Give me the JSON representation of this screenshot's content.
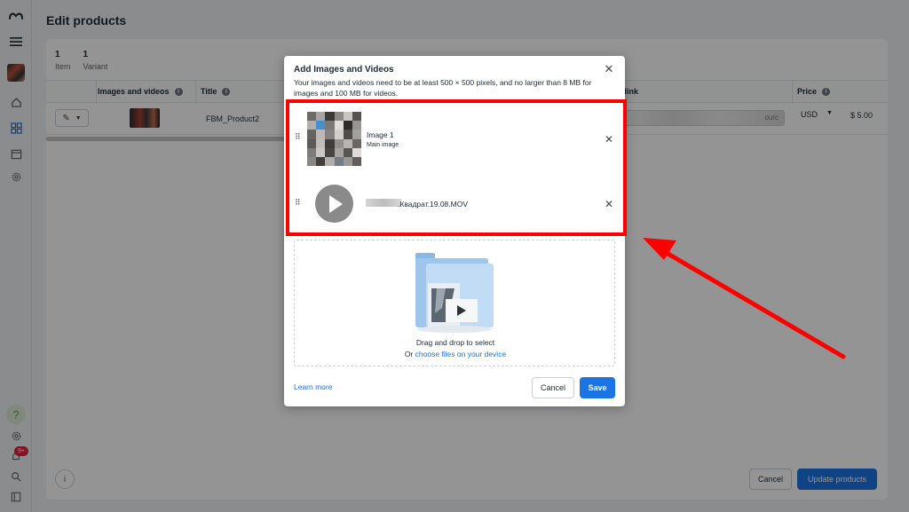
{
  "page": {
    "title": "Edit products"
  },
  "summary": [
    {
      "count": "1",
      "label": "Item"
    },
    {
      "count": "1",
      "label": "Variant"
    }
  ],
  "table": {
    "columns": {
      "images": "Images and videos",
      "title": "Title",
      "link": "e link",
      "price": "Price"
    },
    "row": {
      "title": "FBM_Product2",
      "link_suffix": "ourc",
      "currency": "USD",
      "price": "$ 5.00"
    }
  },
  "footer": {
    "cancel": "Cancel",
    "update": "Update products"
  },
  "rail": {
    "notifications_badge": "9+"
  },
  "modal": {
    "title": "Add Images and Videos",
    "description": "Your images and videos need to be at least 500 × 500 pixels, and no larger than 8 MB for images and 100 MB for videos.",
    "items": [
      {
        "name": "Image 1",
        "subtitle": "Main image"
      },
      {
        "name": ".Квадрат.19.08.MOV"
      }
    ],
    "dropzone": {
      "text": "Drag and drop to select",
      "or": "Or",
      "link": "choose files on your device"
    },
    "learn_more": "Learn more",
    "cancel": "Cancel",
    "save": "Save"
  },
  "colors": {
    "accent": "#1b74e4",
    "annotation": "#ff0000"
  }
}
